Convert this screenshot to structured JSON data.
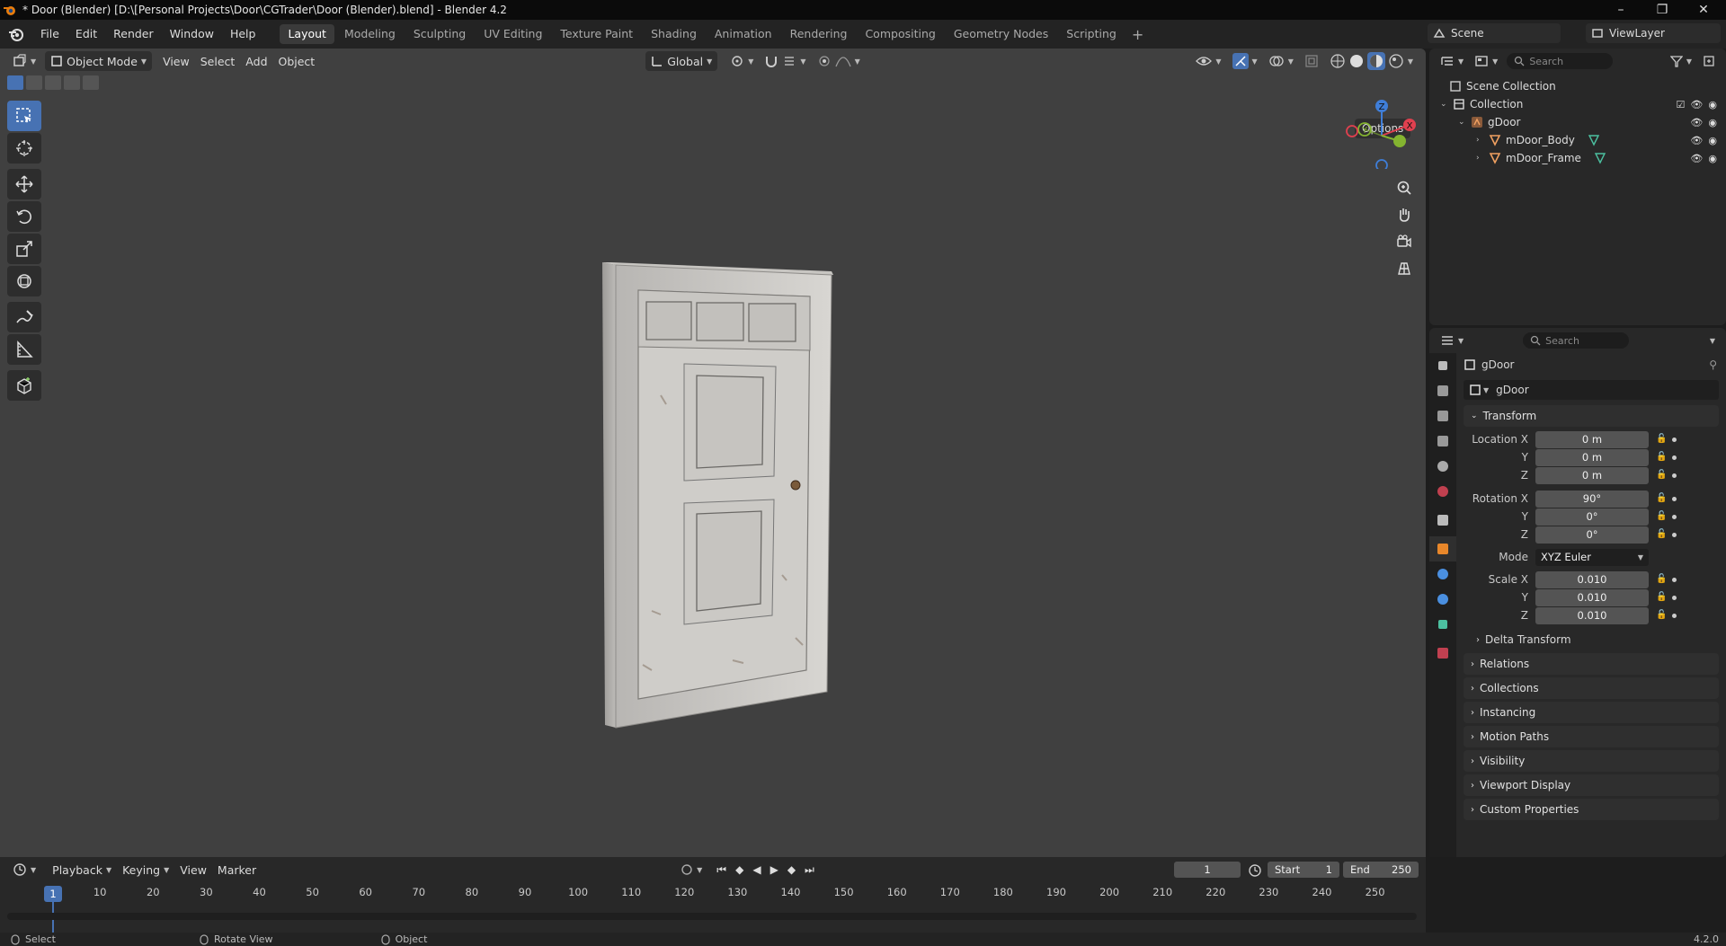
{
  "window": {
    "title": "* Door (Blender) [D:\\[Personal Projects\\Door\\CGTrader\\Door (Blender).blend] - Blender 4.2",
    "minimize": "–",
    "maximize": "❐",
    "close": "✕"
  },
  "menubar": {
    "items": [
      "File",
      "Edit",
      "Render",
      "Window",
      "Help"
    ],
    "workspaces": [
      "Layout",
      "Modeling",
      "Sculpting",
      "UV Editing",
      "Texture Paint",
      "Shading",
      "Animation",
      "Rendering",
      "Compositing",
      "Geometry Nodes",
      "Scripting"
    ],
    "active_workspace": "Layout",
    "add_workspace": "+",
    "scene": "Scene",
    "view_layer": "ViewLayer"
  },
  "viewport": {
    "mode": "Object Mode",
    "menus": [
      "View",
      "Select",
      "Add",
      "Object"
    ],
    "orientation": "Global",
    "options_label": "Options",
    "gizmo_axes": {
      "x": "X",
      "y": "Y",
      "z": "Z"
    },
    "colors": {
      "x": "#e0404f",
      "y": "#84b430",
      "z": "#3f7ed8",
      "accent": "#4772b3",
      "background": "#404040"
    }
  },
  "tools": [
    "select-box-icon",
    "cursor-icon",
    "move-icon",
    "rotate-icon",
    "scale-icon",
    "transform-icon",
    "annotate-icon",
    "measure-icon",
    "add-cube-icon"
  ],
  "outliner": {
    "search_placeholder": "Search",
    "scene_collection": "Scene Collection",
    "collection": "Collection",
    "objects": [
      "gDoor",
      "mDoor_Body",
      "mDoor_Frame"
    ]
  },
  "properties": {
    "search_placeholder": "Search",
    "object_name": "gDoor",
    "object_field": "gDoor",
    "transform_label": "Transform",
    "location_label": "Location X",
    "rotation_label": "Rotation X",
    "scale_label": "Scale X",
    "y_label": "Y",
    "z_label": "Z",
    "mode_label": "Mode",
    "location": [
      "0 m",
      "0 m",
      "0 m"
    ],
    "rotation": [
      "90°",
      "0°",
      "0°"
    ],
    "rotation_mode": "XYZ Euler",
    "scale": [
      "0.010",
      "0.010",
      "0.010"
    ],
    "delta_transform": "Delta Transform",
    "panels": [
      "Relations",
      "Collections",
      "Instancing",
      "Motion Paths",
      "Visibility",
      "Viewport Display",
      "Custom Properties"
    ]
  },
  "timeline": {
    "menus": [
      "Playback",
      "Keying",
      "View",
      "Marker"
    ],
    "current_frame": "1",
    "start_label": "Start",
    "start": "1",
    "end_label": "End",
    "end": "250",
    "ruler": [
      "1",
      "10",
      "20",
      "30",
      "40",
      "50",
      "60",
      "70",
      "80",
      "90",
      "100",
      "110",
      "120",
      "130",
      "140",
      "150",
      "160",
      "170",
      "180",
      "190",
      "200",
      "210",
      "220",
      "230",
      "240",
      "250"
    ]
  },
  "statusbar": {
    "select": "Select",
    "rotate_view": "Rotate View",
    "object": "Object",
    "version": "4.2.0"
  }
}
